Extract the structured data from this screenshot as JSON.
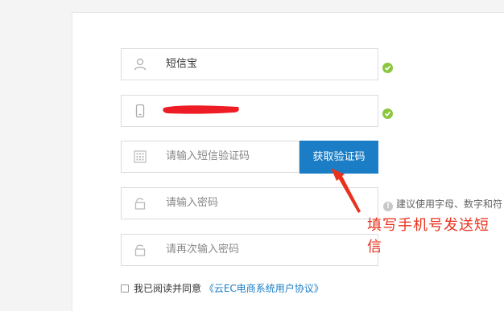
{
  "form": {
    "username": {
      "value": "短信宝",
      "icon": "user-icon"
    },
    "phone": {
      "value": "",
      "icon": "phone-icon",
      "status_color": "#8cc63f"
    },
    "sms_code": {
      "placeholder": "请输入短信验证码",
      "icon": "keypad-icon"
    },
    "get_code_button": "获取验证码",
    "password": {
      "placeholder": "请输入密码",
      "icon": "lock-icon"
    },
    "password_confirm": {
      "placeholder": "请再次输入密码",
      "icon": "lock-icon"
    },
    "password_hint": "建议使用字母、数字和符",
    "agreement": {
      "prefix": "我已阅读并同意",
      "link": "《云EC电商系统用户协议》"
    }
  },
  "annotation": {
    "text": "填写手机号发送短信",
    "color": "#e8321e"
  },
  "colors": {
    "primary": "#1a7dc6",
    "success": "#8cc63f",
    "redaction": "#ee1c24"
  }
}
